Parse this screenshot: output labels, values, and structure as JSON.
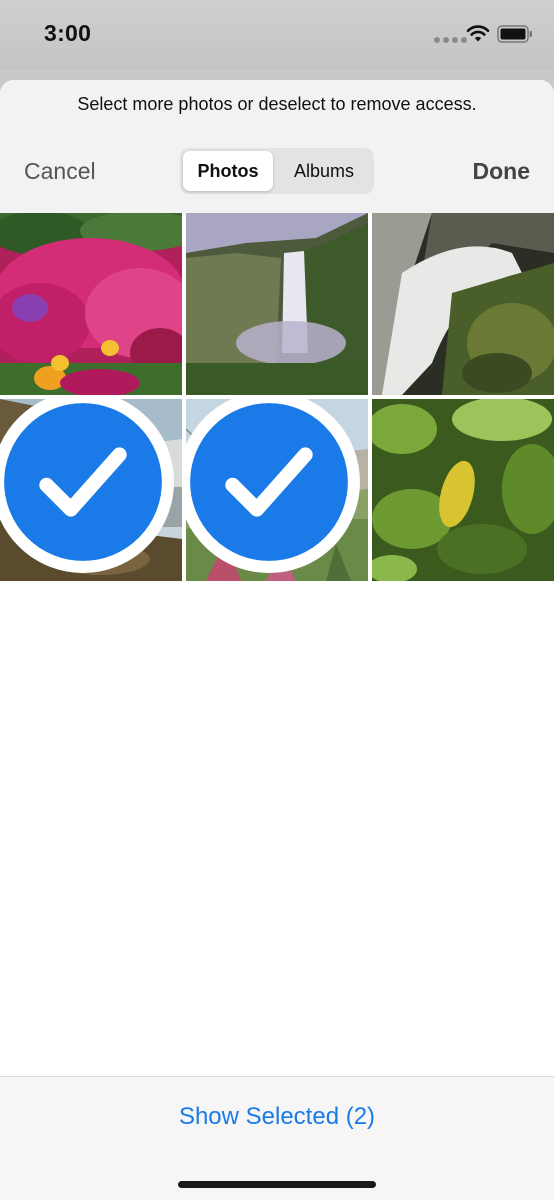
{
  "status_bar": {
    "time": "3:00"
  },
  "sheet": {
    "prompt": "Select more photos or deselect to remove access.",
    "cancel_label": "Cancel",
    "done_label": "Done",
    "segments": [
      {
        "label": "Photos",
        "selected": true
      },
      {
        "label": "Albums",
        "selected": false
      }
    ]
  },
  "photos": [
    {
      "subject": "pink flowers",
      "selected": false
    },
    {
      "subject": "waterfall cliff",
      "selected": false
    },
    {
      "subject": "waterfall close-up",
      "selected": false
    },
    {
      "subject": "misty waterfall",
      "selected": true
    },
    {
      "subject": "beach succulents",
      "selected": true
    },
    {
      "subject": "green leaves",
      "selected": false
    }
  ],
  "bottom_bar": {
    "show_selected_label": "Show Selected (2)"
  },
  "colors": {
    "accent": "#1a7ae8",
    "sheet_header": "#f2f2f2",
    "status_bar": "#c9c9c9"
  }
}
